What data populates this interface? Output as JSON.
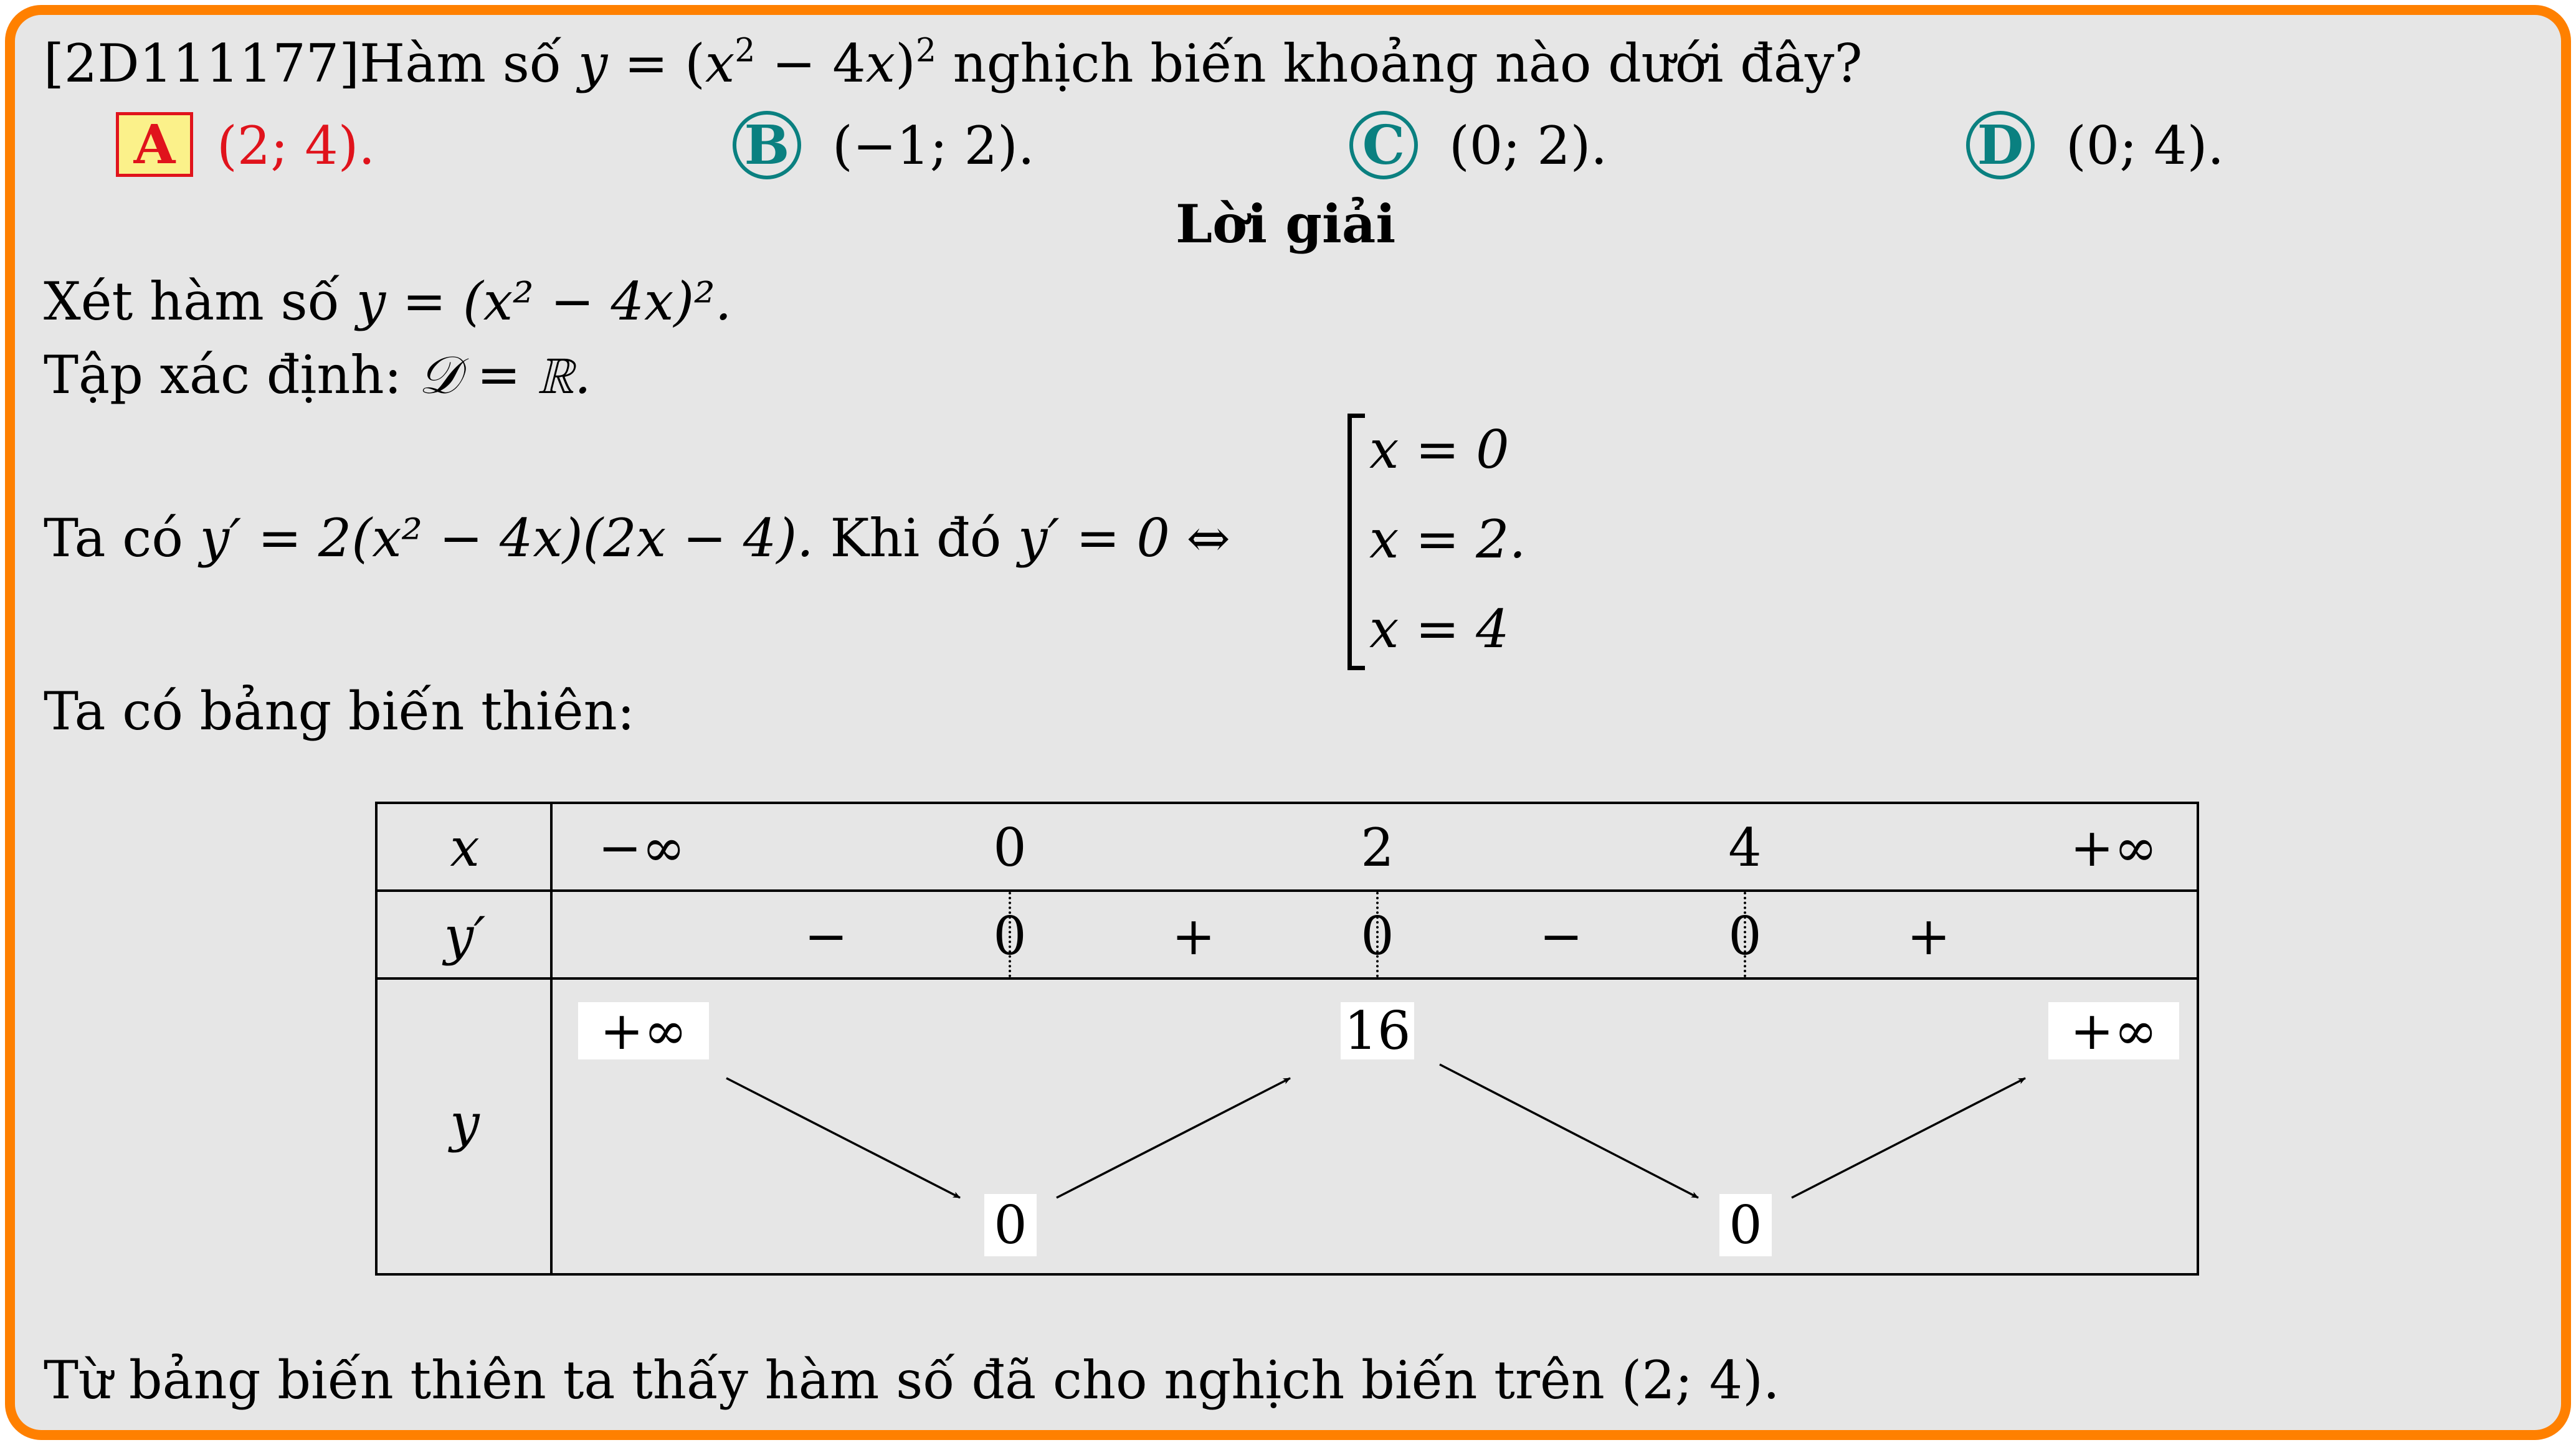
{
  "question": {
    "code": "[2D111177]",
    "text_before": "Hàm số ",
    "formula_y": "y",
    "formula_eq": " = (",
    "formula_x": "x",
    "formula_sq": "2",
    "formula_mid": " − 4",
    "formula_x2": "x",
    "formula_close": ")",
    "formula_sq2": "2",
    "text_after": " nghịch biến khoảng nào dưới đây?"
  },
  "choices": [
    {
      "letter": "A",
      "text": "(2; 4).",
      "correct": true
    },
    {
      "letter": "B",
      "text": "(−1; 2).",
      "correct": false
    },
    {
      "letter": "C",
      "text": "(0; 2).",
      "correct": false
    },
    {
      "letter": "D",
      "text": "(0; 4).",
      "correct": false
    }
  ],
  "solution": {
    "heading": "Lời giải",
    "line1_text": "Xét hàm số ",
    "line1_formula": "y = (x² − 4x)².",
    "line2_text": "Tập xác định: ",
    "line2_formula": "𝒟 = ℝ.",
    "line3_text": "Ta có ",
    "line3_formula": "y′ = 2(x² − 4x)(2x − 4).",
    "line3_text2": " Khi đó ",
    "line3_formula2": "y′ = 0 ⇔",
    "cases": [
      "x = 0",
      "x = 2.",
      "x = 4"
    ],
    "line4_text": "Ta có bảng biến thiên:",
    "conclusion": "Từ bảng biến thiên ta thấy hàm số đã cho nghịch biến trên (2; 4)."
  },
  "table": {
    "row_labels": [
      "x",
      "y′",
      "y"
    ],
    "x_values": [
      "−∞",
      "0",
      "2",
      "4",
      "+∞"
    ],
    "derivative_signs": [
      "−",
      "+",
      "−",
      "+"
    ],
    "derivative_zeros": [
      "0",
      "0",
      "0"
    ],
    "y_values": {
      "top": [
        "+∞",
        "16",
        "+∞"
      ],
      "bottom": [
        "0",
        "0"
      ]
    }
  },
  "colors": {
    "frame": "#ff8000",
    "background": "#e6e6e6",
    "choice_circle": "#0a8080",
    "correct_answer": "#e0131c",
    "correct_fill": "#fbf18a"
  }
}
